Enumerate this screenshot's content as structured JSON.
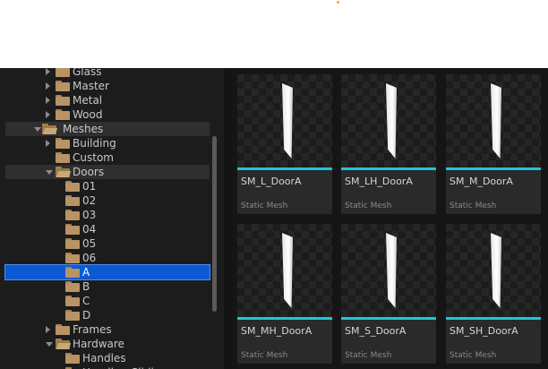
{
  "colors": {
    "accent_mesh": "#1ec6d9",
    "selection": "#0a5bd3",
    "folder": "#b89464",
    "indicator_dot": "#f2a900"
  },
  "tree": {
    "items": [
      {
        "label": "Glass",
        "depth": 1,
        "state": "collapsed",
        "icon": "folder-icon"
      },
      {
        "label": "Master",
        "depth": 1,
        "state": "collapsed",
        "icon": "folder-icon"
      },
      {
        "label": "Metal",
        "depth": 1,
        "state": "collapsed",
        "icon": "folder-icon"
      },
      {
        "label": "Wood",
        "depth": 1,
        "state": "collapsed",
        "icon": "folder-icon"
      },
      {
        "label": "Meshes",
        "depth": 0,
        "state": "expanded",
        "icon": "folder-open-icon"
      },
      {
        "label": "Building",
        "depth": 1,
        "state": "collapsed",
        "icon": "folder-icon"
      },
      {
        "label": "Custom",
        "depth": 1,
        "state": "leaf",
        "icon": "folder-icon"
      },
      {
        "label": "Doors",
        "depth": 1,
        "state": "expanded",
        "icon": "folder-open-icon"
      },
      {
        "label": "01",
        "depth": 2,
        "state": "leaf",
        "icon": "folder-icon"
      },
      {
        "label": "02",
        "depth": 2,
        "state": "leaf",
        "icon": "folder-icon"
      },
      {
        "label": "03",
        "depth": 2,
        "state": "leaf",
        "icon": "folder-icon"
      },
      {
        "label": "04",
        "depth": 2,
        "state": "leaf",
        "icon": "folder-icon"
      },
      {
        "label": "05",
        "depth": 2,
        "state": "leaf",
        "icon": "folder-icon"
      },
      {
        "label": "06",
        "depth": 2,
        "state": "leaf",
        "icon": "folder-icon"
      },
      {
        "label": "A",
        "depth": 2,
        "state": "leaf",
        "icon": "folder-icon",
        "selected": true
      },
      {
        "label": "B",
        "depth": 2,
        "state": "leaf",
        "icon": "folder-icon"
      },
      {
        "label": "C",
        "depth": 2,
        "state": "leaf",
        "icon": "folder-icon"
      },
      {
        "label": "D",
        "depth": 2,
        "state": "leaf",
        "icon": "folder-icon"
      },
      {
        "label": "Frames",
        "depth": 1,
        "state": "collapsed",
        "icon": "folder-icon"
      },
      {
        "label": "Hardware",
        "depth": 1,
        "state": "expanded",
        "icon": "folder-open-icon"
      },
      {
        "label": "Handles",
        "depth": 2,
        "state": "leaf",
        "icon": "folder-icon"
      },
      {
        "label": "Handles_Sliding",
        "depth": 2,
        "state": "leaf",
        "icon": "folder-icon"
      }
    ]
  },
  "assets": [
    {
      "name": "SM_L_DoorA",
      "type": "Static Mesh"
    },
    {
      "name": "SM_LH_DoorA",
      "type": "Static Mesh"
    },
    {
      "name": "SM_M_DoorA",
      "type": "Static Mesh"
    },
    {
      "name": "SM_MH_DoorA",
      "type": "Static Mesh"
    },
    {
      "name": "SM_S_DoorA",
      "type": "Static Mesh"
    },
    {
      "name": "SM_SH_DoorA",
      "type": "Static Mesh"
    }
  ]
}
